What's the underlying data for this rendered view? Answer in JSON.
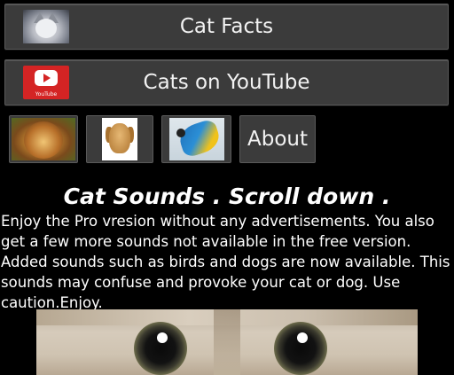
{
  "buttons": {
    "cat_facts": {
      "label": "Cat Facts",
      "icon": "cat-photo-icon"
    },
    "youtube": {
      "label": "Cats on YouTube",
      "icon": "youtube-logo-icon",
      "icon_text": "YouTube"
    },
    "lion": {
      "icon": "lion-photo-icon"
    },
    "dog": {
      "icon": "dog-photo-icon"
    },
    "parrot": {
      "icon": "parrot-photo-icon"
    },
    "about": {
      "label": "About"
    }
  },
  "content": {
    "heading": "Cat Sounds . Scroll down .",
    "description": "Enjoy the Pro vresion without any advertisements. You also get a few more sounds not available in the free version. Added sounds such as birds and dogs are now available. This sounds may confuse and provoke your cat or dog. Use caution.Enjoy."
  },
  "colors": {
    "background": "#000000",
    "button_bg": "#3b3b3b",
    "button_border": "#5a5a5a",
    "text": "#ffffff",
    "youtube_red": "#d42424"
  }
}
